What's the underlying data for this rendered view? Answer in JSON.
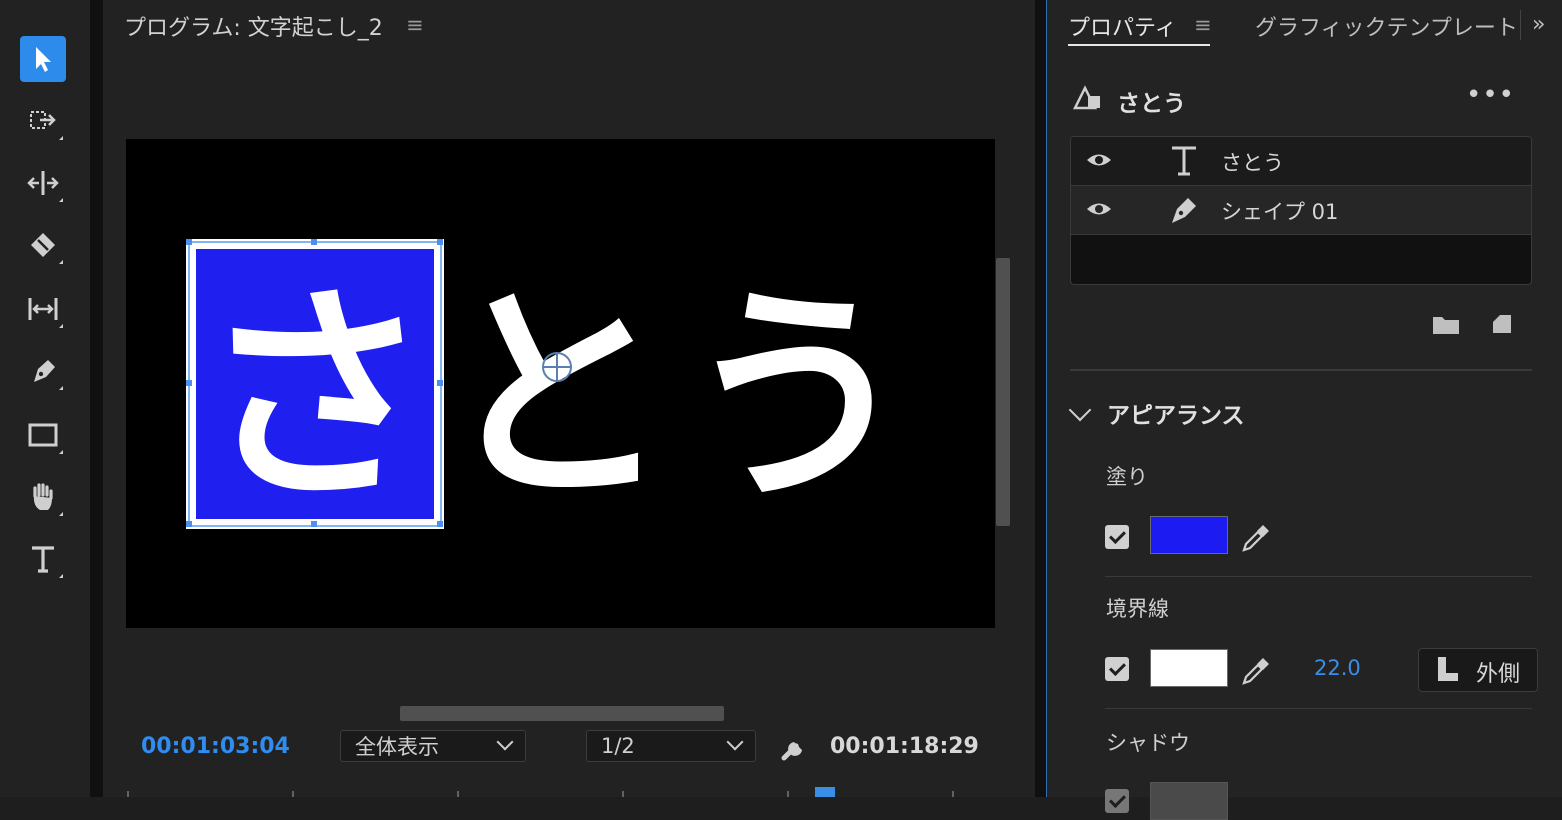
{
  "tools": {
    "items": [
      {
        "name": "selection-tool",
        "active": true
      },
      {
        "name": "track-select-tool",
        "active": false
      },
      {
        "name": "ripple-edit-tool",
        "active": false
      },
      {
        "name": "razor-tool",
        "active": false
      },
      {
        "name": "slip-tool",
        "active": false
      },
      {
        "name": "pen-tool",
        "active": false
      },
      {
        "name": "rectangle-tool",
        "active": false
      },
      {
        "name": "hand-tool",
        "active": false
      },
      {
        "name": "type-tool",
        "active": false
      }
    ],
    "accent": "#2d8ceb"
  },
  "monitor": {
    "title": "プログラム: 文字起こし_2",
    "menu_icon": "≡",
    "video_text": [
      "さ",
      "と",
      "う"
    ],
    "highlight_color": "#1f1ff0",
    "timecode_current": "00:01:03:04",
    "timecode_duration": "00:01:18:29",
    "zoom_label": "全体表示",
    "resolution_label": "1/2"
  },
  "panel": {
    "tab_properties": "プロパティ",
    "tab_menu": "≡",
    "tab_graphics": "グラフィックテンプレート",
    "more": "»",
    "layer_name": "さとう",
    "overflow": "•••",
    "layers": [
      {
        "label": "さとう",
        "kind": "text-layer-icon"
      },
      {
        "label": "シェイプ 01",
        "kind": "pen-layer-icon"
      }
    ],
    "appearance_title": "アピアランス",
    "fill_label": "塗り",
    "fill_color": "#1c1cf2",
    "stroke_label": "境界線",
    "stroke_color": "#ffffff",
    "stroke_width": "22.0",
    "stroke_position": "外側",
    "shadow_label": "シャドウ",
    "shadow_color": "#4a4a4a"
  }
}
